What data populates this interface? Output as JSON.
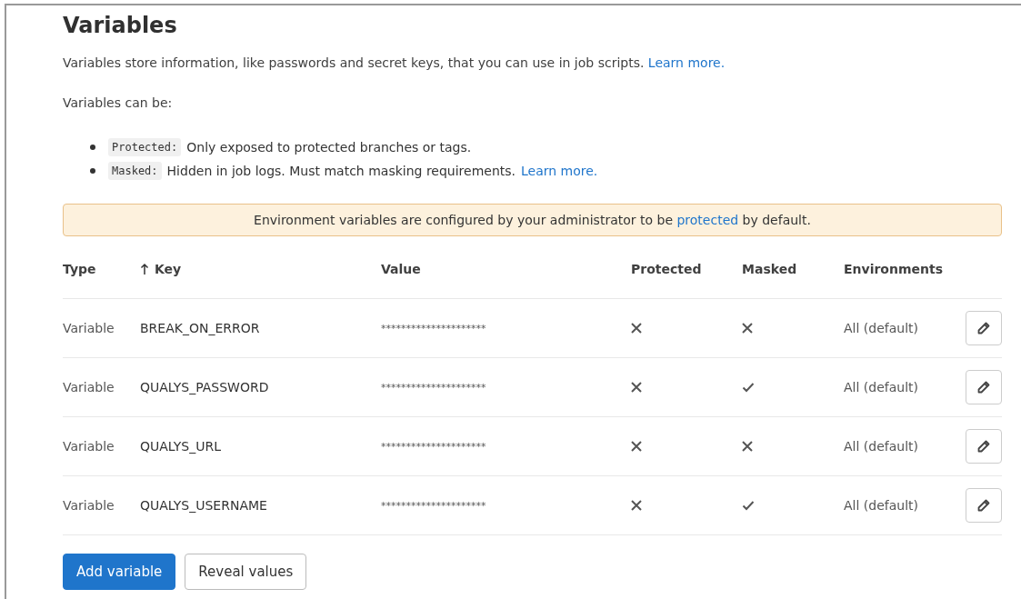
{
  "title": "Variables",
  "description": {
    "text": "Variables store information, like passwords and secret keys, that you can use in job scripts.",
    "link": "Learn more."
  },
  "intro": "Variables can be:",
  "bullets": [
    {
      "code": "Protected:",
      "text": "Only exposed to protected branches or tags."
    },
    {
      "code": "Masked:",
      "text": "Hidden in job logs. Must match masking requirements.",
      "link": "Learn more."
    }
  ],
  "alert": {
    "before": "Environment variables are configured by your administrator to be",
    "link": "protected",
    "after": "by default."
  },
  "table": {
    "columns": [
      {
        "label": "Type",
        "sort_icon": false
      },
      {
        "label": "Key",
        "sort_icon": true
      },
      {
        "label": "Value",
        "sort_icon": false
      },
      {
        "label": "Protected",
        "sort_icon": false
      },
      {
        "label": "Masked",
        "sort_icon": false
      },
      {
        "label": "Environments",
        "sort_icon": false
      }
    ],
    "rows": [
      {
        "type": "Variable",
        "key": "BREAK_ON_ERROR",
        "value": "*********************",
        "protected": false,
        "masked": false,
        "environments": "All (default)"
      },
      {
        "type": "Variable",
        "key": "QUALYS_PASSWORD",
        "value": "*********************",
        "protected": false,
        "masked": true,
        "environments": "All (default)"
      },
      {
        "type": "Variable",
        "key": "QUALYS_URL",
        "value": "*********************",
        "protected": false,
        "masked": false,
        "environments": "All (default)"
      },
      {
        "type": "Variable",
        "key": "QUALYS_USERNAME",
        "value": "*********************",
        "protected": false,
        "masked": true,
        "environments": "All (default)"
      }
    ]
  },
  "buttons": [
    {
      "label": "Add variable",
      "kind": "primary"
    },
    {
      "label": "Reveal values",
      "kind": "secondary"
    }
  ]
}
